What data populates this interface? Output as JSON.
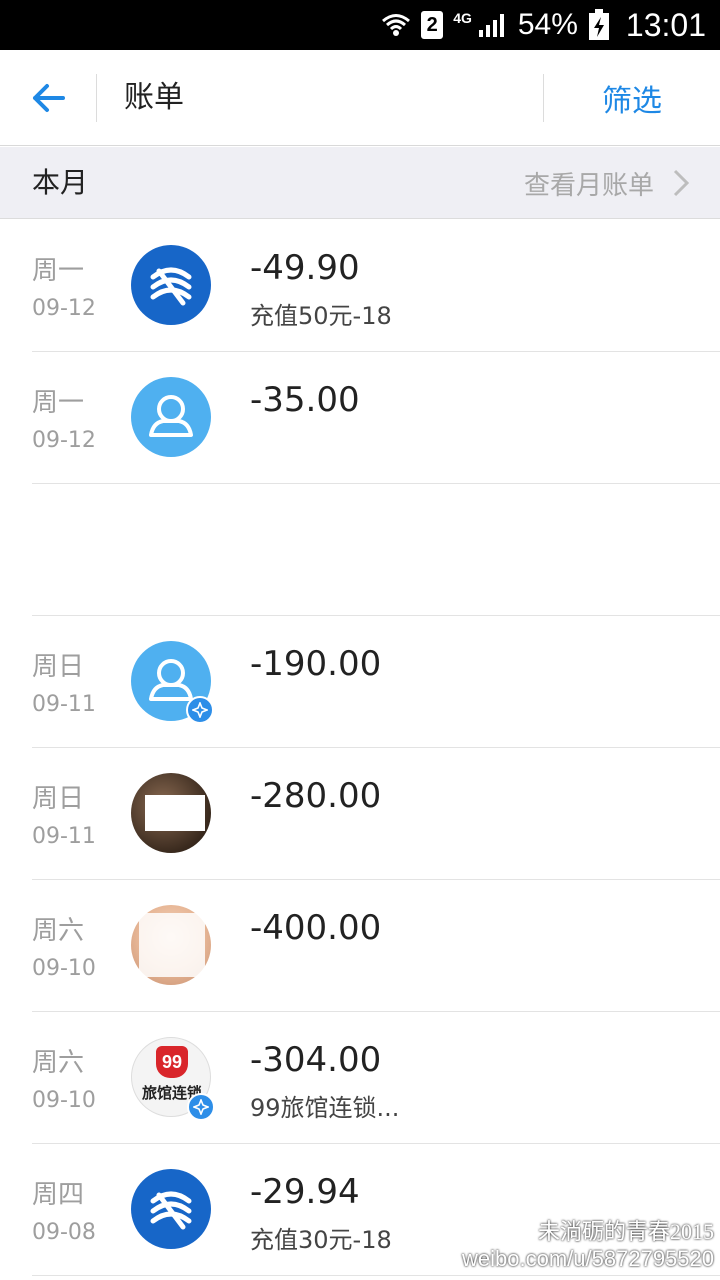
{
  "status_bar": {
    "sim": "2",
    "network": "4G",
    "battery": "54%",
    "time": "13:01"
  },
  "header": {
    "title": "账单",
    "filter_label": "筛选"
  },
  "month_bar": {
    "label": "本月",
    "link": "查看月账单"
  },
  "bills": [
    {
      "day": "周一",
      "date": "09-12",
      "amount": "-49.90",
      "desc": "充值50元-18",
      "avatar": "china-mobile-logo",
      "badge": false
    },
    {
      "day": "周一",
      "date": "09-12",
      "amount": "-35.00",
      "desc": "",
      "avatar": "default-user-icon",
      "badge": false
    },
    {
      "day": "",
      "date": "",
      "amount": "",
      "desc": "",
      "avatar": "",
      "badge": false
    },
    {
      "day": "周日",
      "date": "09-11",
      "amount": "-190.00",
      "desc": "",
      "avatar": "default-user-icon",
      "badge": true
    },
    {
      "day": "周日",
      "date": "09-11",
      "amount": "-280.00",
      "desc": "",
      "avatar": "photo",
      "badge": false
    },
    {
      "day": "周六",
      "date": "09-10",
      "amount": "-400.00",
      "desc": "",
      "avatar": "photo",
      "badge": false
    },
    {
      "day": "周六",
      "date": "09-10",
      "amount": "-304.00",
      "desc": "99旅馆连锁...",
      "avatar": "hotel-logo",
      "badge": true
    },
    {
      "day": "周四",
      "date": "09-08",
      "amount": "-29.94",
      "desc": "充值30元-18",
      "avatar": "china-mobile-logo",
      "badge": false
    }
  ],
  "hotel_logo": {
    "number": "99",
    "text": "旅馆连锁"
  },
  "watermark": {
    "name": "未淌砺的青春2015",
    "url": "weibo.com/u/5872795520"
  },
  "colors": {
    "accent": "#1e88e5",
    "month_bar_bg": "#efeff4",
    "china_mobile": "#1766c8",
    "default_avatar": "#4fb0f0"
  }
}
